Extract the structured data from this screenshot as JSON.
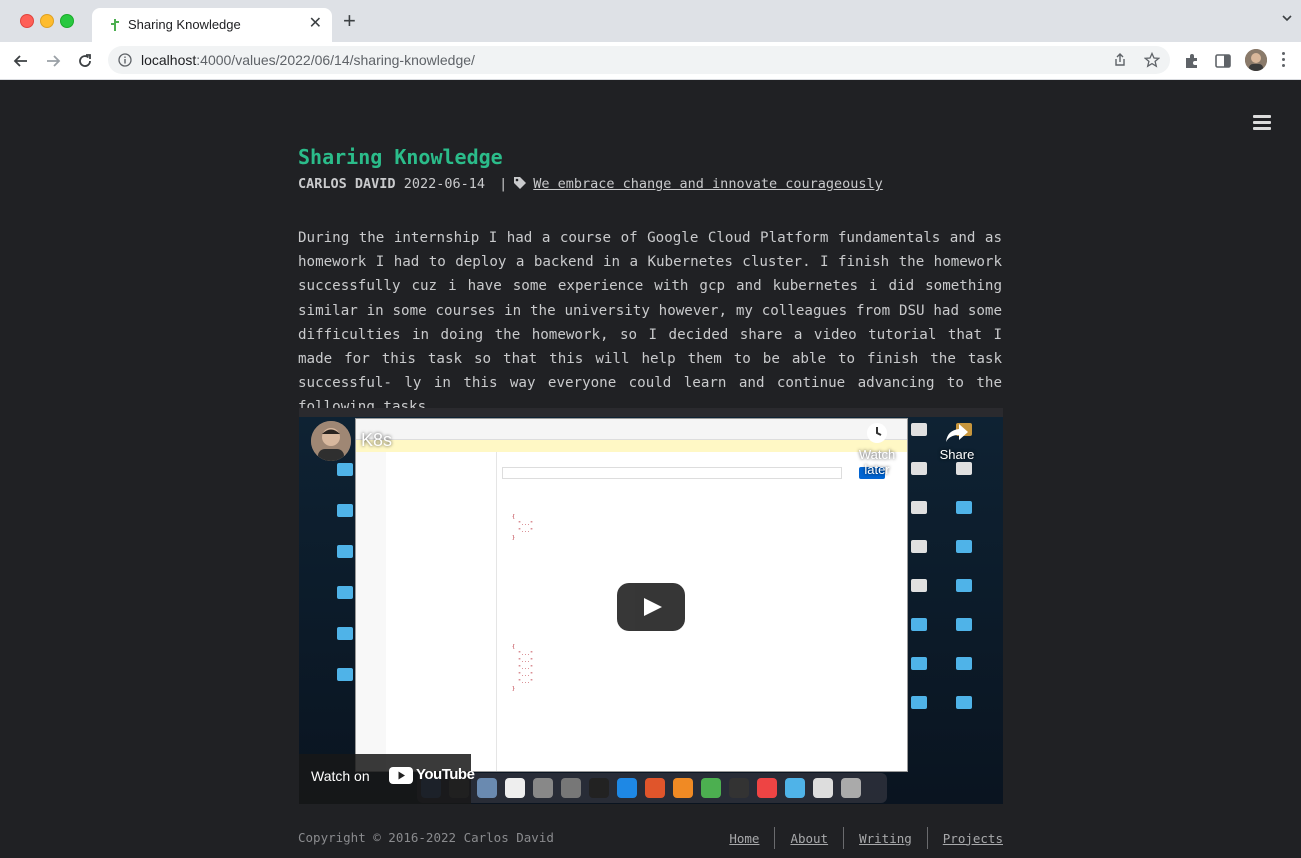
{
  "browser": {
    "tab_title": "Sharing Knowledge",
    "new_tab_symbol": "+",
    "close_symbol": "✕",
    "url_host": "localhost",
    "url_path": ":4000/values/2022/06/14/sharing-knowledge/"
  },
  "post": {
    "title": "Sharing Knowledge",
    "author": "CARLOS DAVID",
    "date": "2022-06-14",
    "separator": "|",
    "tag": "We embrace change and innovate courageously",
    "body": "During the internship I had a course of Google Cloud Platform fundamentals and as homework I had to deploy a backend in a Kubernetes cluster. I finish the homework successfully cuz i have some experience with gcp and kubernetes i did something similar in some courses in the university however, my colleagues from DSU had some difficulties in doing the homework, so I decided share a video tutorial that I made for this task so that this will help them to be able to finish the task successful- ly in this way everyone could learn and continue advancing to the following tasks."
  },
  "video": {
    "title": "K8s",
    "watch_later": "Watch later",
    "share": "Share",
    "watch_on": "Watch on",
    "youtube": "YouTube"
  },
  "footer": {
    "copyright": "Copyright © 2016-2022 Carlos David",
    "nav": [
      "Home",
      "About",
      "Writing",
      "Projects"
    ]
  },
  "colors": {
    "accent": "#2bbc8a",
    "background": "#202124",
    "text": "#c9cacc"
  },
  "icons": [
    "info-icon",
    "share-icon",
    "star-icon",
    "extensions-icon",
    "sidepanel-icon",
    "tag-icon",
    "hamburger-icon",
    "play-icon",
    "clock-icon"
  ]
}
